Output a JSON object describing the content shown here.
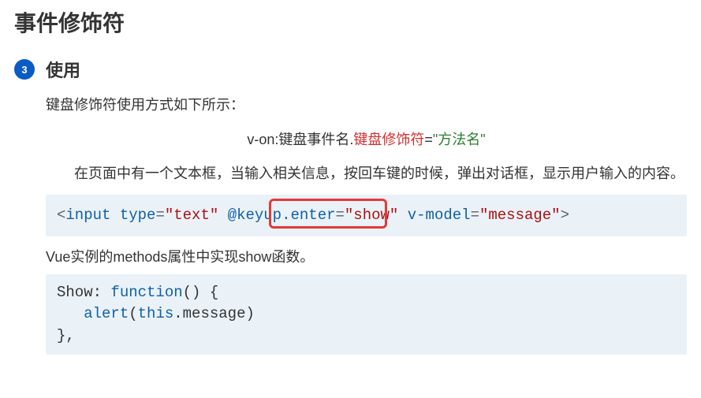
{
  "main_title": "事件修饰符",
  "section": {
    "number": "3",
    "title": "使用",
    "intro": "键盘修饰符使用方式如下所示：",
    "syntax": {
      "part1": "v-on:键盘事件名.",
      "part_red": "键盘修饰符",
      "part_eq": "=",
      "part_green": "\"方法名\"",
      "full_plain": "v-on:键盘事件名.键盘修饰符=\"方法名\""
    },
    "description": "在页面中有一个文本框，当输入相关信息，按回车键的时候，弹出对话框，显示用户输入的内容。",
    "code1": {
      "lt": "<",
      "tag": "input",
      "attr1_name": "type",
      "attr1_val": "\"text\"",
      "attr2_name": "@keyup.enter",
      "attr2_val": "\"show\"",
      "attr3_name": "v-model",
      "attr3_val": "\"message\"",
      "gt": ">",
      "eq": "="
    },
    "followup": "Vue实例的methods属性中实现show函数。",
    "code2": {
      "line1_key": "Show",
      "line1_colon": ": ",
      "line1_func": "function",
      "line1_paren": "() {",
      "line2_indent": "   ",
      "line2_alert": "alert",
      "line2_open": "(",
      "line2_this": "this",
      "line2_dot": ".message)",
      "line3": "},"
    }
  }
}
